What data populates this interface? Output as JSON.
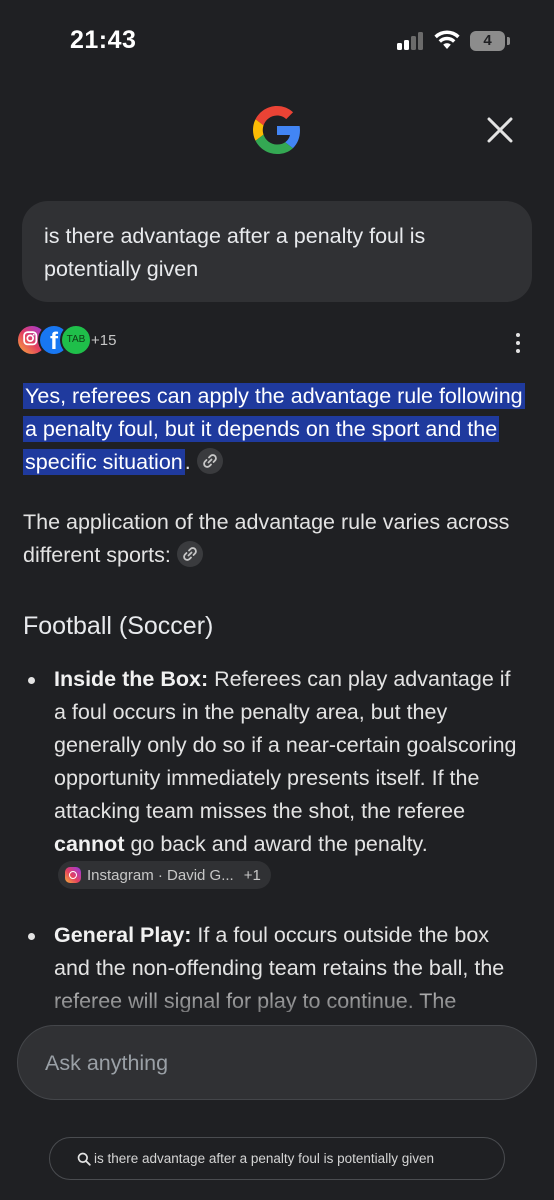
{
  "status_bar": {
    "time": "21:43",
    "battery": "4"
  },
  "query": "is there advantage after a penalty foul is potentially given",
  "sources": {
    "more_count": "+15",
    "icons": [
      "instagram-icon",
      "facebook-icon",
      "tab-icon"
    ],
    "tab_label": "TAB"
  },
  "answer": {
    "highlight": "Yes, referees can apply the advantage rule following a penalty foul, but it depends on the sport and the specific situation",
    "highlight_end": ".",
    "para2": "The application of the advantage rule varies across different sports:",
    "section_title": "Football (Soccer)",
    "bullets": [
      {
        "lead": "Inside the Box:",
        "text1": " Referees can play advantage if a foul occurs in the penalty area, but they generally only do so if a near-certain goalscoring opportunity immediately presents itself. If the attacking team misses the shot, the referee ",
        "bold": "cannot",
        "text2": " go back and award the penalty.",
        "citation": {
          "source": "Instagram · David G...",
          "extra": "+1"
        }
      },
      {
        "lead": "General Play:",
        "text1": " If a foul occurs outside the box and the non-offending team retains the ball, the referee will signal for play to continue. The"
      }
    ]
  },
  "ask": {
    "placeholder": "Ask anything"
  },
  "suggestion": "is there advantage after a penalty foul is potentially given",
  "colors": {
    "highlight": "#1f3a9e",
    "background": "#1f2023",
    "surface": "#303134"
  }
}
